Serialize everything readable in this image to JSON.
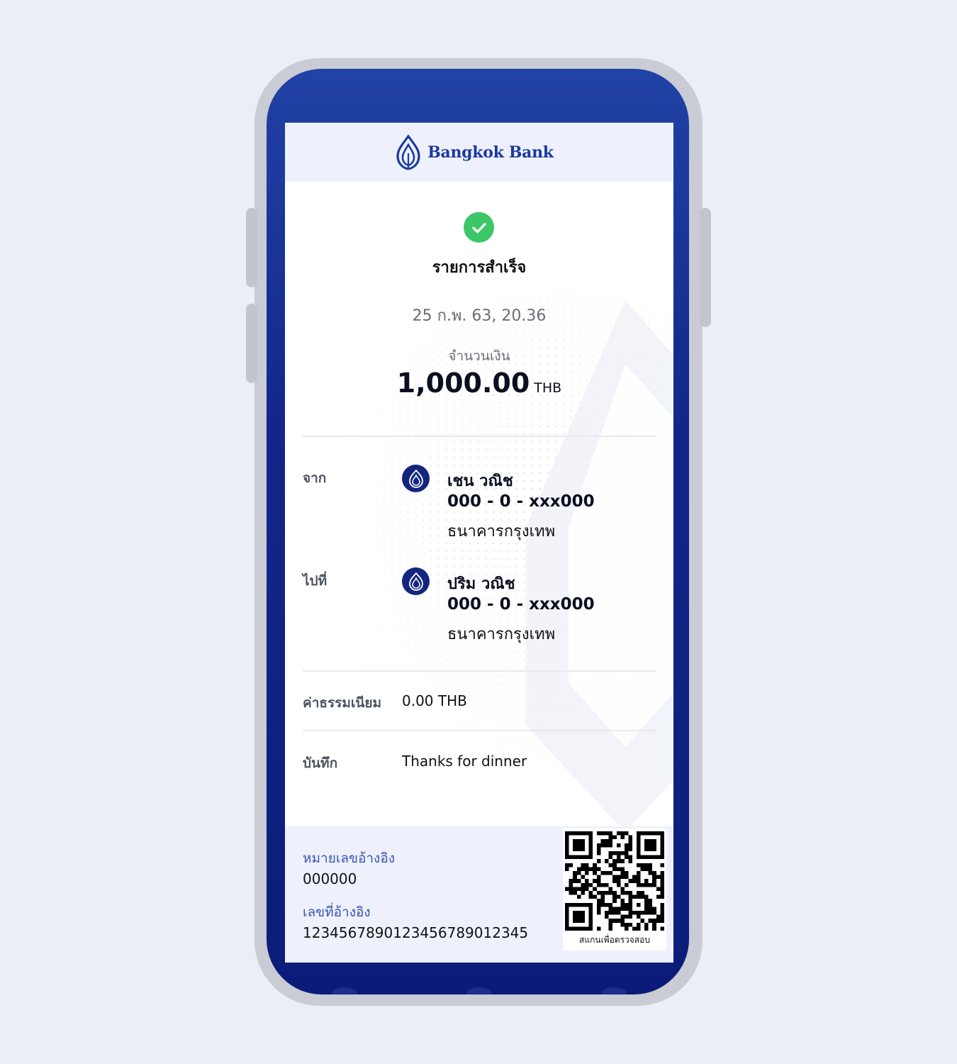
{
  "header": {
    "brand_name": "Bangkok Bank",
    "logo_icon": "lotus-logo-icon"
  },
  "status": {
    "icon": "check-icon",
    "title": "รายการสำเร็จ"
  },
  "transaction": {
    "date_time": "25 ก.พ. 63, 20.36",
    "amount_label": "จำนวนเงิน",
    "amount": "1,000.00",
    "currency": "THB"
  },
  "from": {
    "label": "จาก",
    "name": "เชน วณิช",
    "account": "000 - 0 - xxx000",
    "bank": "ธนาคารกรุงเทพ"
  },
  "to": {
    "label": "ไปที่",
    "name": "ปริม วณิช",
    "account": "000 - 0 - xxx000",
    "bank": "ธนาคารกรุงเทพ"
  },
  "fee": {
    "label": "ค่าธรรมเนียม",
    "value": "0.00 THB"
  },
  "memo": {
    "label": "บันทึก",
    "value": "Thanks for dinner"
  },
  "footer": {
    "ref_label": "หมายเลขอ้างอิง",
    "ref_value": "000000",
    "ref_no_label": "เลขที่อ้างอิง",
    "ref_no_value": "1234567890123456789012345",
    "qr_caption": "สแกนเพื่อตรวจสอบ"
  },
  "colors": {
    "brand_blue": "#1b3aa0",
    "frame_blue": "#13278a",
    "success_green": "#3dc667",
    "link_blue": "#3a55b4"
  }
}
